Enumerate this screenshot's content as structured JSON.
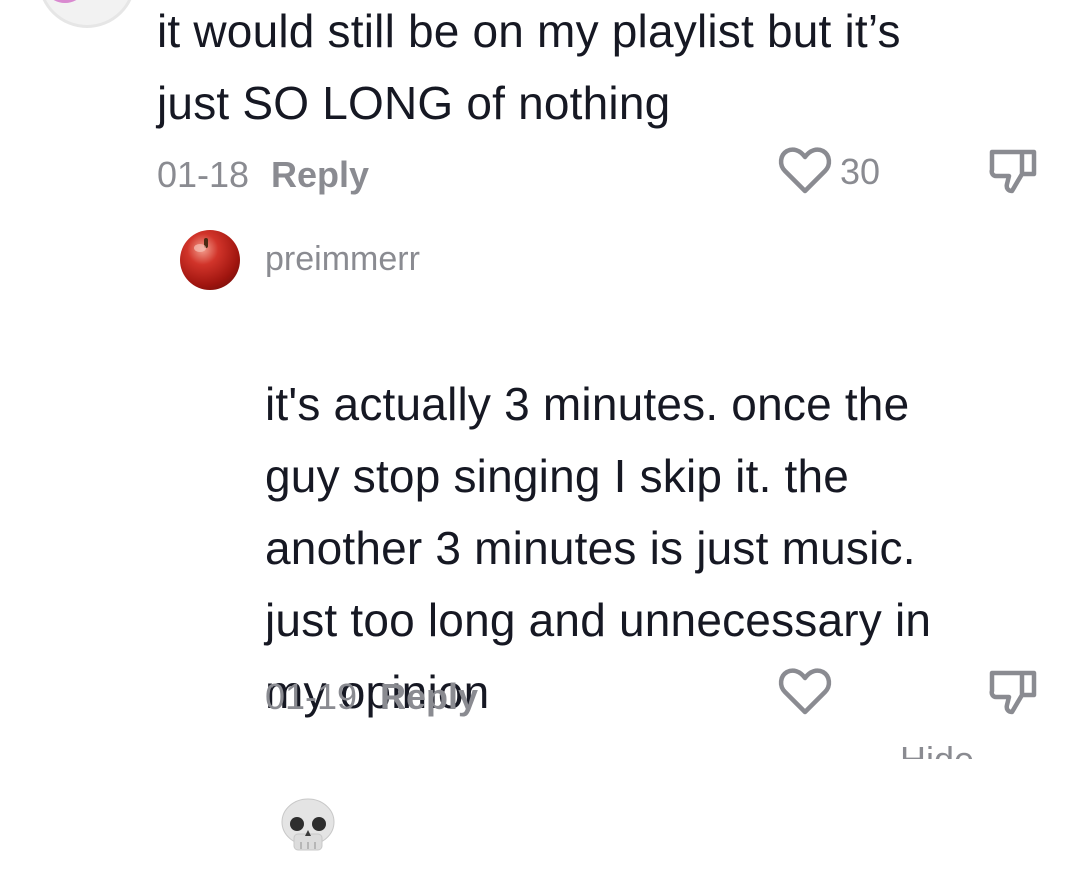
{
  "top_comment": {
    "text": "it would still be on my playlist but it’s\njust SO LONG of nothing",
    "date": "01-18",
    "reply_label": "Reply",
    "like_count": "30"
  },
  "reply_comment": {
    "username": "preimmerr",
    "text": "it's actually 3 minutes. once the\nguy stop singing I skip it. the\nanother 3 minutes is just music.\njust too long and unnecessary in\nmy opinion",
    "emoji": "skull-emoji",
    "date": "01-19",
    "reply_label": "Reply"
  },
  "footer": {
    "hide_label": "Hide"
  },
  "icons": {
    "like": "heart-outline-icon",
    "dislike": "thumbs-down-icon"
  },
  "colors": {
    "text": "#161823",
    "muted": "#8a8b91"
  }
}
